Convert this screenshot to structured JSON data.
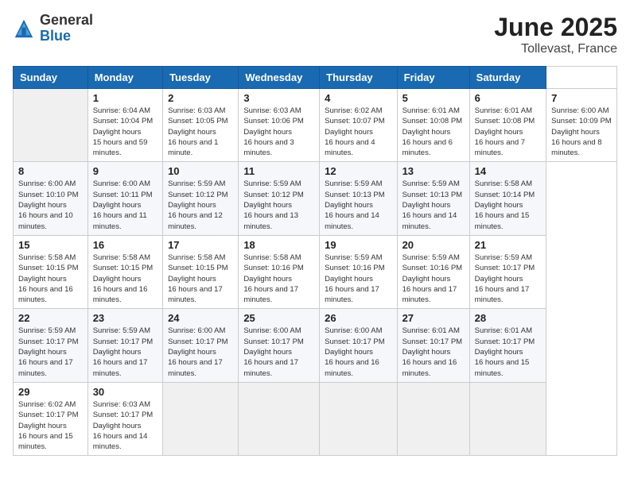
{
  "header": {
    "logo_general": "General",
    "logo_blue": "Blue",
    "month_title": "June 2025",
    "location": "Tollevast, France"
  },
  "calendar": {
    "days_of_week": [
      "Sunday",
      "Monday",
      "Tuesday",
      "Wednesday",
      "Thursday",
      "Friday",
      "Saturday"
    ],
    "weeks": [
      [
        null,
        {
          "day": "1",
          "sunrise": "Sunrise: 6:04 AM",
          "sunset": "Sunset: 10:04 PM",
          "daylight": "Daylight: 15 hours and 59 minutes."
        },
        {
          "day": "2",
          "sunrise": "Sunrise: 6:03 AM",
          "sunset": "Sunset: 10:05 PM",
          "daylight": "Daylight: 16 hours and 1 minute."
        },
        {
          "day": "3",
          "sunrise": "Sunrise: 6:03 AM",
          "sunset": "Sunset: 10:06 PM",
          "daylight": "Daylight: 16 hours and 3 minutes."
        },
        {
          "day": "4",
          "sunrise": "Sunrise: 6:02 AM",
          "sunset": "Sunset: 10:07 PM",
          "daylight": "Daylight: 16 hours and 4 minutes."
        },
        {
          "day": "5",
          "sunrise": "Sunrise: 6:01 AM",
          "sunset": "Sunset: 10:08 PM",
          "daylight": "Daylight: 16 hours and 6 minutes."
        },
        {
          "day": "6",
          "sunrise": "Sunrise: 6:01 AM",
          "sunset": "Sunset: 10:08 PM",
          "daylight": "Daylight: 16 hours and 7 minutes."
        },
        {
          "day": "7",
          "sunrise": "Sunrise: 6:00 AM",
          "sunset": "Sunset: 10:09 PM",
          "daylight": "Daylight: 16 hours and 8 minutes."
        }
      ],
      [
        {
          "day": "8",
          "sunrise": "Sunrise: 6:00 AM",
          "sunset": "Sunset: 10:10 PM",
          "daylight": "Daylight: 16 hours and 10 minutes."
        },
        {
          "day": "9",
          "sunrise": "Sunrise: 6:00 AM",
          "sunset": "Sunset: 10:11 PM",
          "daylight": "Daylight: 16 hours and 11 minutes."
        },
        {
          "day": "10",
          "sunrise": "Sunrise: 5:59 AM",
          "sunset": "Sunset: 10:12 PM",
          "daylight": "Daylight: 16 hours and 12 minutes."
        },
        {
          "day": "11",
          "sunrise": "Sunrise: 5:59 AM",
          "sunset": "Sunset: 10:12 PM",
          "daylight": "Daylight: 16 hours and 13 minutes."
        },
        {
          "day": "12",
          "sunrise": "Sunrise: 5:59 AM",
          "sunset": "Sunset: 10:13 PM",
          "daylight": "Daylight: 16 hours and 14 minutes."
        },
        {
          "day": "13",
          "sunrise": "Sunrise: 5:59 AM",
          "sunset": "Sunset: 10:13 PM",
          "daylight": "Daylight: 16 hours and 14 minutes."
        },
        {
          "day": "14",
          "sunrise": "Sunrise: 5:58 AM",
          "sunset": "Sunset: 10:14 PM",
          "daylight": "Daylight: 16 hours and 15 minutes."
        }
      ],
      [
        {
          "day": "15",
          "sunrise": "Sunrise: 5:58 AM",
          "sunset": "Sunset: 10:15 PM",
          "daylight": "Daylight: 16 hours and 16 minutes."
        },
        {
          "day": "16",
          "sunrise": "Sunrise: 5:58 AM",
          "sunset": "Sunset: 10:15 PM",
          "daylight": "Daylight: 16 hours and 16 minutes."
        },
        {
          "day": "17",
          "sunrise": "Sunrise: 5:58 AM",
          "sunset": "Sunset: 10:15 PM",
          "daylight": "Daylight: 16 hours and 17 minutes."
        },
        {
          "day": "18",
          "sunrise": "Sunrise: 5:58 AM",
          "sunset": "Sunset: 10:16 PM",
          "daylight": "Daylight: 16 hours and 17 minutes."
        },
        {
          "day": "19",
          "sunrise": "Sunrise: 5:59 AM",
          "sunset": "Sunset: 10:16 PM",
          "daylight": "Daylight: 16 hours and 17 minutes."
        },
        {
          "day": "20",
          "sunrise": "Sunrise: 5:59 AM",
          "sunset": "Sunset: 10:16 PM",
          "daylight": "Daylight: 16 hours and 17 minutes."
        },
        {
          "day": "21",
          "sunrise": "Sunrise: 5:59 AM",
          "sunset": "Sunset: 10:17 PM",
          "daylight": "Daylight: 16 hours and 17 minutes."
        }
      ],
      [
        {
          "day": "22",
          "sunrise": "Sunrise: 5:59 AM",
          "sunset": "Sunset: 10:17 PM",
          "daylight": "Daylight: 16 hours and 17 minutes."
        },
        {
          "day": "23",
          "sunrise": "Sunrise: 5:59 AM",
          "sunset": "Sunset: 10:17 PM",
          "daylight": "Daylight: 16 hours and 17 minutes."
        },
        {
          "day": "24",
          "sunrise": "Sunrise: 6:00 AM",
          "sunset": "Sunset: 10:17 PM",
          "daylight": "Daylight: 16 hours and 17 minutes."
        },
        {
          "day": "25",
          "sunrise": "Sunrise: 6:00 AM",
          "sunset": "Sunset: 10:17 PM",
          "daylight": "Daylight: 16 hours and 17 minutes."
        },
        {
          "day": "26",
          "sunrise": "Sunrise: 6:00 AM",
          "sunset": "Sunset: 10:17 PM",
          "daylight": "Daylight: 16 hours and 16 minutes."
        },
        {
          "day": "27",
          "sunrise": "Sunrise: 6:01 AM",
          "sunset": "Sunset: 10:17 PM",
          "daylight": "Daylight: 16 hours and 16 minutes."
        },
        {
          "day": "28",
          "sunrise": "Sunrise: 6:01 AM",
          "sunset": "Sunset: 10:17 PM",
          "daylight": "Daylight: 16 hours and 15 minutes."
        }
      ],
      [
        {
          "day": "29",
          "sunrise": "Sunrise: 6:02 AM",
          "sunset": "Sunset: 10:17 PM",
          "daylight": "Daylight: 16 hours and 15 minutes."
        },
        {
          "day": "30",
          "sunrise": "Sunrise: 6:03 AM",
          "sunset": "Sunset: 10:17 PM",
          "daylight": "Daylight: 16 hours and 14 minutes."
        },
        null,
        null,
        null,
        null,
        null
      ]
    ]
  }
}
